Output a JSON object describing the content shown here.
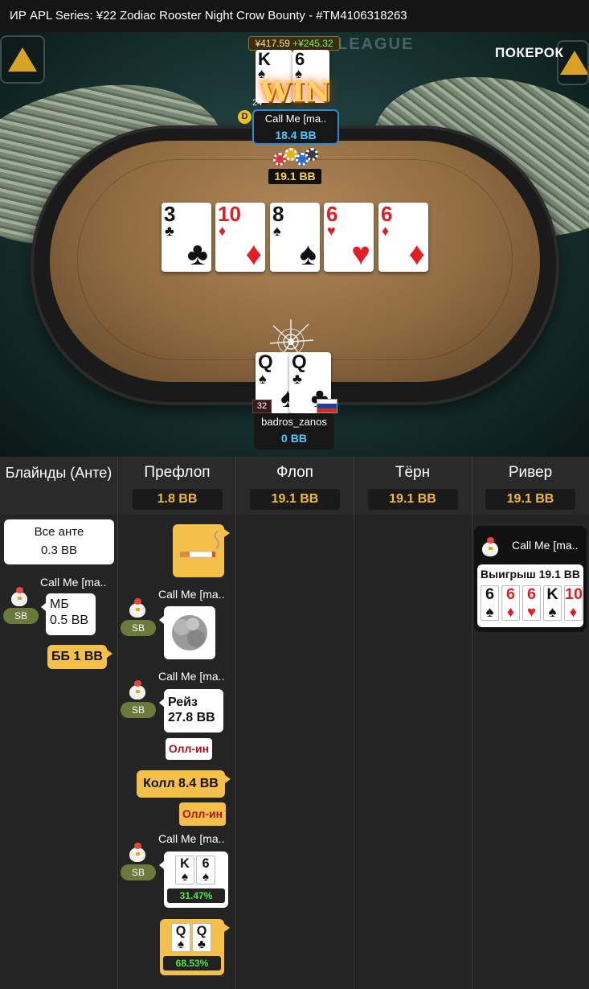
{
  "title": "ИР  APL Series: ¥22 Zodiac Rooster Night Crow Bounty   - #TM4106318263",
  "table": {
    "league_text": "LEAGUE",
    "brand": "ПОКЕРОК",
    "top_player": {
      "stack_badge_amount": "¥417.59",
      "stack_badge_gain": "+¥245.32",
      "cards": [
        {
          "rank": "K",
          "suit": "♠",
          "color": "black"
        },
        {
          "rank": "6",
          "suit": "♠",
          "color": "black"
        }
      ],
      "win_label": "WIN",
      "level": "24",
      "dealer_button": "D",
      "name": "Call Me [ma..",
      "stack": "18.4 BB"
    },
    "pot": "19.1 BB",
    "board": [
      {
        "rank": "3",
        "suit": "♣",
        "color": "black"
      },
      {
        "rank": "10",
        "suit": "♦",
        "color": "red"
      },
      {
        "rank": "8",
        "suit": "♠",
        "color": "black"
      },
      {
        "rank": "6",
        "suit": "♥",
        "color": "red"
      },
      {
        "rank": "6",
        "suit": "♦",
        "color": "red"
      }
    ],
    "hero": {
      "cards": [
        {
          "rank": "Q",
          "suit": "♠",
          "color": "black"
        },
        {
          "rank": "Q",
          "suit": "♣",
          "color": "black"
        }
      ],
      "level": "32",
      "name": "badros_zanos",
      "stack": "0 BB",
      "flag_colors": [
        "#ffffff",
        "#1b3fa6",
        "#d52b1e"
      ]
    }
  },
  "history": {
    "columns": [
      {
        "label": "Блайнды (Анте)",
        "pot": ""
      },
      {
        "label": "Префлоп",
        "pot": "1.8 BB"
      },
      {
        "label": "Флоп",
        "pot": "19.1 BB"
      },
      {
        "label": "Тёрн",
        "pot": "19.1 BB"
      },
      {
        "label": "Ривер",
        "pot": "19.1 BB"
      }
    ],
    "blinds": {
      "ante_line1": "Все анте",
      "ante_line2": "0.3 BB",
      "sb_player": "Call Me [ma..",
      "sb_badge": "SB",
      "sb_action_line1": "МБ",
      "sb_action_line2": "0.5 BB",
      "bb_action": "ББ 1 BB"
    },
    "preflop": {
      "hero_action_icon": "cigarette-icon",
      "p1_name": "Call Me [ma..",
      "p1_badge": "SB",
      "p1_action_icon": "smoke-cloud-icon",
      "p2_name": "Call Me [ma..",
      "p2_badge": "SB",
      "p2_action_line1": "Рейз",
      "p2_action_line2": "27.8 BB",
      "p2_allin": "Олл-ин",
      "hero_call": "Колл 8.4 BB",
      "hero_allin": "Олл-ин",
      "p3_name": "Call Me [ma..",
      "p3_badge": "SB",
      "p3_cards": [
        {
          "rank": "K",
          "suit": "♠",
          "color": "black"
        },
        {
          "rank": "6",
          "suit": "♠",
          "color": "black"
        }
      ],
      "p3_equity": "31.47%",
      "hero_cards": [
        {
          "rank": "Q",
          "suit": "♠",
          "color": "black"
        },
        {
          "rank": "Q",
          "suit": "♣",
          "color": "black"
        }
      ],
      "hero_equity": "68.53%"
    },
    "river": {
      "winner_name": "Call Me [ma..",
      "win_text": "Выигрыш 19.1 BB",
      "win_cards": [
        {
          "rank": "6",
          "suit": "♠",
          "color": "black"
        },
        {
          "rank": "6",
          "suit": "♦",
          "color": "red"
        },
        {
          "rank": "6",
          "suit": "♥",
          "color": "red"
        },
        {
          "rank": "K",
          "suit": "♠",
          "color": "black"
        },
        {
          "rank": "10",
          "suit": "♦",
          "color": "red"
        }
      ]
    }
  },
  "colors": {
    "accent_gold": "#f4c04a",
    "pot_text": "#f0b93a",
    "stack_blue": "#4cc9ff",
    "allin_red": "#b1121b",
    "equity_green": "#4fe34a"
  }
}
